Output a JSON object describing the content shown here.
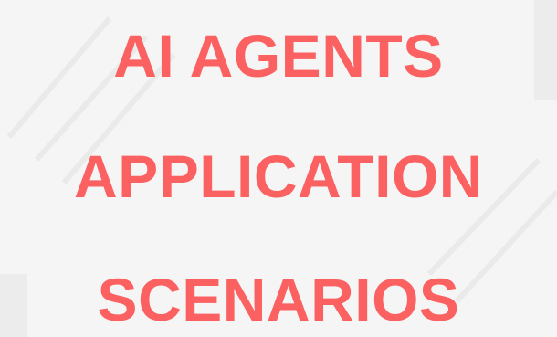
{
  "headline": {
    "line_1": "AI AGENTS",
    "line_2": "APPLICATION",
    "line_3": "SCENARIOS"
  },
  "colors": {
    "text": "#fb6161",
    "background": "#f5f5f5",
    "texture": "#dedede"
  }
}
